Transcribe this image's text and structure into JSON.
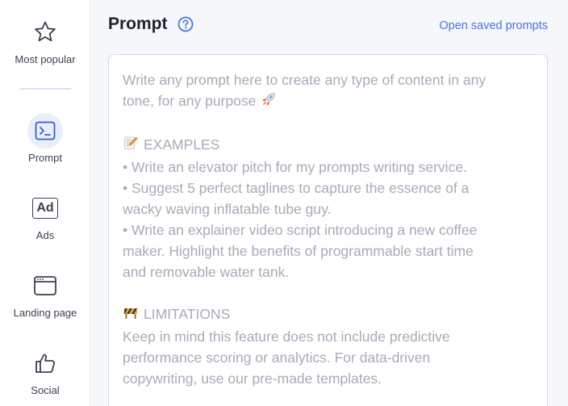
{
  "sidebar": {
    "items": [
      {
        "label": "Most popular",
        "icon": "star-icon"
      },
      {
        "label": "Prompt",
        "icon": "terminal-icon"
      },
      {
        "label": "Ads",
        "icon": "ad-icon",
        "icon_text": "Ad"
      },
      {
        "label": "Landing page",
        "icon": "browser-window-icon"
      },
      {
        "label": "Social",
        "icon": "thumbs-up-icon"
      }
    ]
  },
  "header": {
    "title": "Prompt",
    "saved_link": "Open saved prompts"
  },
  "prompt": {
    "lines": [
      "Write any prompt here to create any type of content in any",
      "tone, for any purpose"
    ],
    "examples_heading": "EXAMPLES",
    "examples": [
      "• Write an elevator pitch for my prompts writing service.",
      "• Suggest 5 perfect taglines to capture the essence of a",
      "wacky waving inflatable tube guy.",
      "• Write an explainer video script introducing a new coffee",
      "maker. Highlight the benefits of programmable start time",
      "and removable water tank."
    ],
    "limitations_heading": "LIMITATIONS",
    "limitations": [
      "Keep in mind this feature does not include predictive",
      "performance scoring or analytics. For data-driven",
      "copywriting,  use our pre-made templates."
    ]
  },
  "colors": {
    "accent": "#4a73d9",
    "placeholder_text": "#a7abb8",
    "active_icon_bg": "#e8eefc"
  }
}
